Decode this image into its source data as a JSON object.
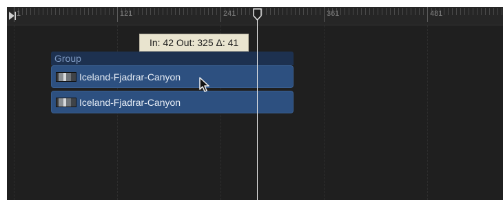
{
  "ruler": {
    "labels": [
      "1",
      "121",
      "241",
      "361",
      "481"
    ]
  },
  "tooltip": {
    "text": "In: 42 Out: 325 Δ: 41"
  },
  "group": {
    "label": "Group",
    "clips": [
      {
        "name": "Iceland-Fjadrar-Canyon"
      },
      {
        "name": "Iceland-Fjadrar-Canyon"
      }
    ]
  },
  "colors": {
    "background": "#1f1f1f",
    "clip": "#2d5080",
    "group_header": "#1d3150",
    "playhead": "#e6e6e6",
    "tooltip": "#e9e4cf"
  },
  "icons": [
    "play-start-icon",
    "playhead-handle-icon",
    "clip-thumbnail-icon",
    "mouse-pointer-icon"
  ]
}
